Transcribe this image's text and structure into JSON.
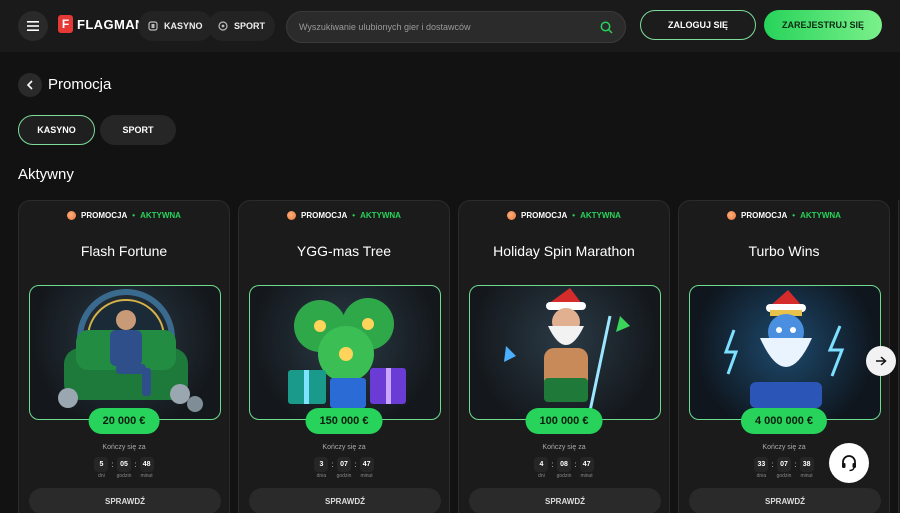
{
  "header": {
    "logo_letter": "F",
    "logo_text": "FLAGMAN",
    "nav": [
      {
        "label": "KASYNO",
        "icon": "slot-icon"
      },
      {
        "label": "SPORT",
        "icon": "ball-icon"
      }
    ],
    "search_placeholder": "Wyszukiwanie ulubionych gier i dostawców",
    "login_label": "ZALOGUJ SIĘ",
    "register_label": "ZAREJESTRUJ SIĘ"
  },
  "page": {
    "title": "Promocja",
    "tabs": [
      "KASYNO",
      "SPORT"
    ],
    "active_tab": "KASYNO",
    "section_title": "Aktywny"
  },
  "colors": {
    "accent_green": "#27d35a",
    "background": "#121212",
    "card": "#1b1b1b"
  },
  "cards": [
    {
      "tag": "PROMOCJA",
      "status": "AKTYWNA",
      "title": "Flash Fortune",
      "image": "man-in-armchair",
      "prize": "20 000 €",
      "ends_label": "Kończy się za",
      "timer": {
        "days": "5",
        "hours": "05",
        "minutes": "48"
      },
      "timer_labels": {
        "days": "dni",
        "hours": "godzin",
        "minutes": "minut"
      },
      "button": "SPRAWDŹ"
    },
    {
      "tag": "PROMOCJA",
      "status": "AKTYWNA",
      "title": "YGG-mas Tree",
      "image": "christmas-tree-gifts",
      "prize": "150 000 €",
      "ends_label": "Kończy się za",
      "timer": {
        "days": "3",
        "hours": "07",
        "minutes": "47"
      },
      "timer_labels": {
        "days": "dnia",
        "hours": "godzin",
        "minutes": "minut"
      },
      "button": "SPRAWDŹ"
    },
    {
      "tag": "PROMOCJA",
      "status": "AKTYWNA",
      "title": "Holiday Spin Marathon",
      "image": "santa-zeus",
      "prize": "100 000 €",
      "ends_label": "Kończy się za",
      "timer": {
        "days": "4",
        "hours": "08",
        "minutes": "47"
      },
      "timer_labels": {
        "days": "dni",
        "hours": "godzin",
        "minutes": "minut"
      },
      "button": "SPRAWDŹ"
    },
    {
      "tag": "PROMOCJA",
      "status": "AKTYWNA",
      "title": "Turbo Wins",
      "image": "ice-zeus",
      "prize": "4 000 000 €",
      "ends_label": "Kończy się za",
      "timer": {
        "days": "33",
        "hours": "07",
        "minutes": "38"
      },
      "timer_labels": {
        "days": "dnia",
        "hours": "godzin",
        "minutes": "minut"
      },
      "button": "SPRAWDŹ"
    }
  ]
}
